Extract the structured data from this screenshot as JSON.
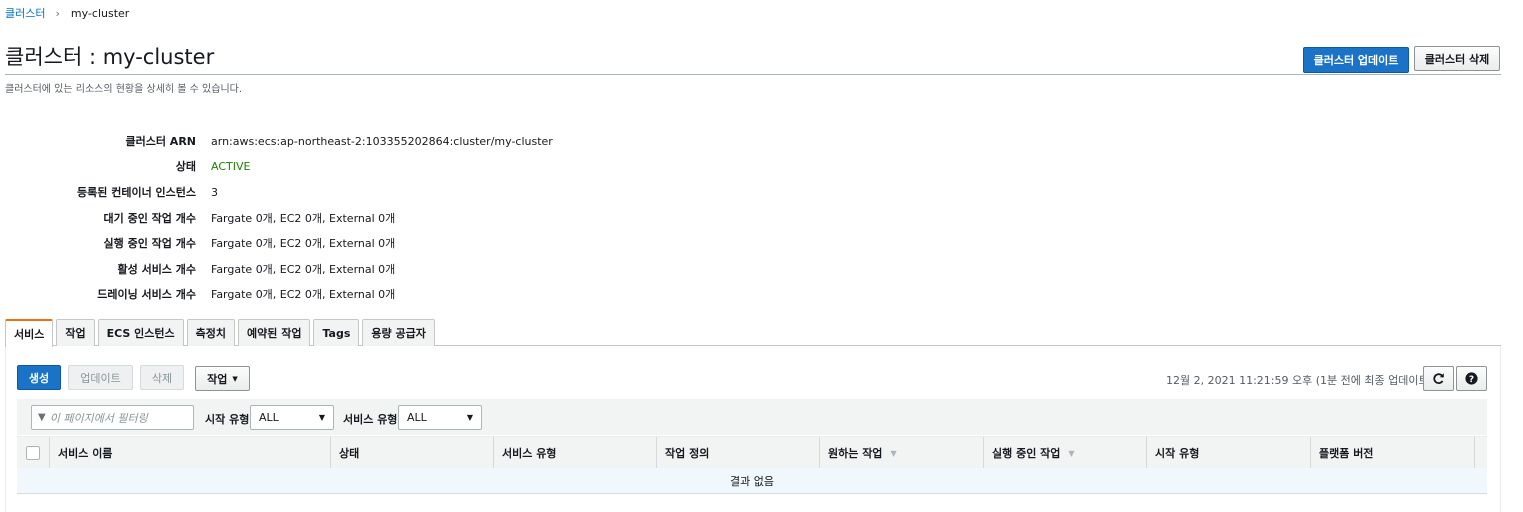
{
  "breadcrumb": {
    "parent": "클러스터",
    "current": "my-cluster"
  },
  "page": {
    "title": "클러스터 : my-cluster",
    "subtitle": "클러스터에 있는 리소스의 현황을 상세히 볼 수 있습니다.",
    "update_button": "클러스터 업데이트",
    "delete_button": "클러스터 삭제"
  },
  "details": [
    {
      "label": "클러스터 ARN",
      "value": "arn:aws:ecs:ap-northeast-2:103355202864:cluster/my-cluster"
    },
    {
      "label": "상태",
      "value": "ACTIVE"
    },
    {
      "label": "등록된 컨테이너 인스턴스",
      "value": "3"
    },
    {
      "label": "대기 중인 작업 개수",
      "value": "Fargate 0개, EC2 0개, External 0개"
    },
    {
      "label": "실행 중인 작업 개수",
      "value": "Fargate 0개, EC2 0개, External 0개"
    },
    {
      "label": "활성 서비스 개수",
      "value": "Fargate 0개, EC2 0개, External 0개"
    },
    {
      "label": "드레이닝 서비스 개수",
      "value": "Fargate 0개, EC2 0개, External 0개"
    }
  ],
  "tabs": [
    {
      "label": "서비스",
      "active": true
    },
    {
      "label": "작업"
    },
    {
      "label": "ECS 인스턴스"
    },
    {
      "label": "측정치"
    },
    {
      "label": "예약된 작업"
    },
    {
      "label": "Tags"
    },
    {
      "label": "용량 공급자"
    }
  ],
  "actions": {
    "create": "생성",
    "update": "업데이트",
    "delete": "삭제",
    "tasks": "작업",
    "last_updated": "12월 2, 2021 11:21:59 오후 (1분 전에 최종 업데이트함"
  },
  "filter": {
    "placeholder": "이 페이지에서 필터링",
    "launch_type_label": "시작 유형",
    "launch_type_value": "ALL",
    "service_type_label": "서비스 유형",
    "service_type_value": "ALL"
  },
  "table": {
    "columns": [
      "서비스 이름",
      "상태",
      "서비스 유형",
      "작업 정의",
      "원하는 작업",
      "실행 중인 작업",
      "시작 유형",
      "플랫폼 버전"
    ],
    "empty_text": "결과 없음"
  },
  "colors": {
    "primary": "#1a73c6",
    "active_status": "#1d8102",
    "tab_accent": "#ec7211",
    "link": "#0073bb"
  },
  "icons": {
    "filter": "filter-icon",
    "refresh": "refresh-icon",
    "help": "help-icon",
    "dropdown": "caret-down-icon"
  }
}
